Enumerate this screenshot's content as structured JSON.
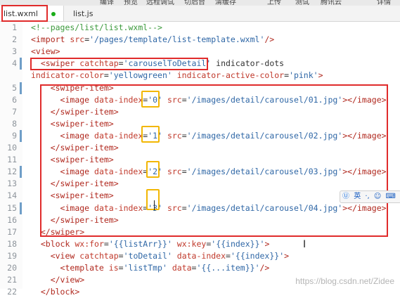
{
  "menu": {
    "items": [
      "编译",
      "预览",
      "远程调试",
      "切后台",
      "清缓存",
      "上传",
      "测试",
      "腾讯云",
      "详情"
    ]
  },
  "tabs": [
    {
      "label": "list.wxml",
      "active": true,
      "modified": true
    },
    {
      "label": "list.js",
      "active": false
    }
  ],
  "lines": [
    {
      "n": "1",
      "t": "<!--pages/list/list.wxml-->"
    },
    {
      "n": "2",
      "t": "<import src='/pages/template/list-template.wxml'/>"
    },
    {
      "n": "3",
      "t": "<view>"
    },
    {
      "n": "4",
      "t": "  <swiper catchtap='carouselToDetail' indicator-dots"
    },
    {
      "n": "",
      "t": "indicator-color='yellowgreen' indicator-active-color='pink'>"
    },
    {
      "n": "5",
      "t": "    <swiper-item>"
    },
    {
      "n": "6",
      "t": "      <image data-index='0' src='/images/detail/carousel/01.jpg'></image>"
    },
    {
      "n": "7",
      "t": "    </swiper-item>"
    },
    {
      "n": "8",
      "t": "    <swiper-item>"
    },
    {
      "n": "9",
      "t": "      <image data-index='1' src='/images/detail/carousel/02.jpg'></image>"
    },
    {
      "n": "10",
      "t": "    </swiper-item>"
    },
    {
      "n": "11",
      "t": "    <swiper-item>"
    },
    {
      "n": "12",
      "t": "      <image data-index='2' src='/images/detail/carousel/03.jpg'></image>"
    },
    {
      "n": "13",
      "t": "    </swiper-item>"
    },
    {
      "n": "14",
      "t": "    <swiper-item>"
    },
    {
      "n": "15",
      "t": "      <image data-index='3' src='/images/detail/carousel/04.jpg'></image>"
    },
    {
      "n": "16",
      "t": "    </swiper-item>"
    },
    {
      "n": "17",
      "t": "  </swiper>"
    },
    {
      "n": "18",
      "t": "  <block wx:for='{{listArr}}' wx:key='{{index}}'>"
    },
    {
      "n": "19",
      "t": "    <view catchtap='toDetail' data-index='{{index}}'>"
    },
    {
      "n": "20",
      "t": "      <template is='listTmp' data='{{...item}}'/>"
    },
    {
      "n": "21",
      "t": "    </view>"
    },
    {
      "n": "22",
      "t": "  </block>"
    }
  ],
  "ime": {
    "items": [
      "英",
      "·,",
      "☺",
      "⌨",
      "⊞",
      "⚙"
    ]
  },
  "watermark": "https://blog.csdn.net/Zidee",
  "colors": {
    "red_box": "#e02b2b",
    "yellow_box": "#f2b705",
    "modified_dot": "#1aad19"
  }
}
